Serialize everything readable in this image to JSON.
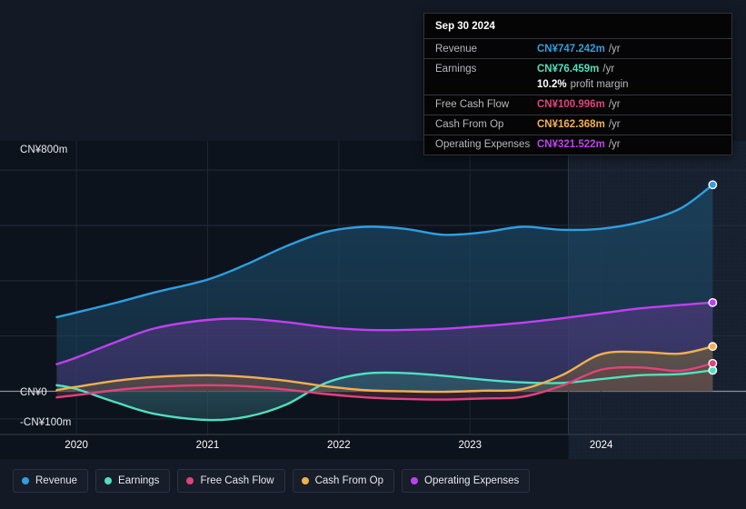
{
  "chart_data": {
    "type": "area",
    "title": "",
    "xlabel": "",
    "ylabel": "",
    "currency": "CN¥",
    "xlim": [
      2019.75,
      2025.0
    ],
    "ylim": [
      -130,
      840
    ],
    "grid": true,
    "x_ticks": [
      "2020",
      "2021",
      "2022",
      "2023",
      "2024"
    ],
    "x_tick_values": [
      2020,
      2021,
      2022,
      2023,
      2024
    ],
    "y_ticks": [
      "CN¥800m",
      "CN¥0",
      "-CN¥100m"
    ],
    "y_tick_values": [
      800,
      0,
      -100
    ],
    "gridline_values": [
      800,
      600,
      400,
      200,
      0,
      -100
    ],
    "forecast_divider_x": 2023.75,
    "legend_position": "bottom-left",
    "series": [
      {
        "name": "Revenue",
        "color": "#2f9fe0",
        "fill": "#1b4764",
        "end_value": 747.242,
        "x": [
          2019.85,
          2020.0,
          2020.3,
          2020.6,
          2021.0,
          2021.3,
          2021.6,
          2021.9,
          2022.2,
          2022.5,
          2022.8,
          2023.1,
          2023.4,
          2023.7,
          2024.0,
          2024.3,
          2024.6,
          2024.85
        ],
        "values": [
          268,
          285,
          320,
          358,
          404,
          460,
          525,
          576,
          595,
          588,
          566,
          575,
          595,
          584,
          588,
          612,
          660,
          747
        ]
      },
      {
        "name": "Earnings",
        "color": "#4fe0c0",
        "fill": "#2f5f6b",
        "end_value": 76.459,
        "x": [
          2019.85,
          2020.0,
          2020.3,
          2020.6,
          2021.0,
          2021.3,
          2021.6,
          2021.9,
          2022.2,
          2022.5,
          2022.8,
          2023.1,
          2023.4,
          2023.7,
          2024.0,
          2024.3,
          2024.6,
          2024.85
        ],
        "values": [
          22,
          8,
          -40,
          -82,
          -104,
          -92,
          -48,
          30,
          64,
          66,
          56,
          42,
          32,
          30,
          44,
          58,
          62,
          76
        ]
      },
      {
        "name": "Free Cash Flow",
        "color": "#e0437e",
        "fill": "#5e2a43",
        "end_value": 100.996,
        "x": [
          2019.85,
          2020.0,
          2020.3,
          2020.6,
          2021.0,
          2021.3,
          2021.6,
          2021.9,
          2022.2,
          2022.5,
          2022.8,
          2023.1,
          2023.4,
          2023.7,
          2024.0,
          2024.3,
          2024.6,
          2024.85
        ],
        "values": [
          -22,
          -14,
          4,
          16,
          22,
          18,
          6,
          -10,
          -22,
          -28,
          -30,
          -26,
          -20,
          20,
          78,
          86,
          74,
          101
        ]
      },
      {
        "name": "Cash From Op",
        "color": "#f0b050",
        "fill": "#6b5a3f",
        "end_value": 162.368,
        "x": [
          2019.85,
          2020.0,
          2020.3,
          2020.6,
          2021.0,
          2021.3,
          2021.6,
          2021.9,
          2022.2,
          2022.5,
          2022.8,
          2023.1,
          2023.4,
          2023.7,
          2024.0,
          2024.3,
          2024.6,
          2024.85
        ],
        "values": [
          4,
          16,
          38,
          52,
          58,
          52,
          38,
          18,
          4,
          0,
          -2,
          2,
          8,
          58,
          134,
          142,
          136,
          162
        ]
      },
      {
        "name": "Operating Expenses",
        "color": "#c040f0",
        "fill": "#4a3878",
        "end_value": 321.522,
        "x": [
          2019.85,
          2020.0,
          2020.3,
          2020.6,
          2021.0,
          2021.3,
          2021.6,
          2021.9,
          2022.2,
          2022.5,
          2022.8,
          2023.1,
          2023.4,
          2023.7,
          2024.0,
          2024.3,
          2024.6,
          2024.85
        ],
        "values": [
          98,
          122,
          178,
          228,
          258,
          262,
          250,
          232,
          222,
          222,
          226,
          236,
          248,
          264,
          282,
          300,
          312,
          321
        ]
      }
    ]
  },
  "tooltip": {
    "date": "Sep 30 2024",
    "rows": [
      {
        "label": "Revenue",
        "value": "CN¥747.242m",
        "unit": "/yr",
        "color": "#2f9fe0"
      },
      {
        "label": "Earnings",
        "value": "CN¥76.459m",
        "unit": "/yr",
        "color": "#4fe0c0"
      },
      {
        "label": "",
        "value": "10.2%",
        "unit": "profit margin",
        "color": "#ffffff",
        "sub": true
      },
      {
        "label": "Free Cash Flow",
        "value": "CN¥100.996m",
        "unit": "/yr",
        "color": "#e0437e"
      },
      {
        "label": "Cash From Op",
        "value": "CN¥162.368m",
        "unit": "/yr",
        "color": "#f0b050"
      },
      {
        "label": "Operating Expenses",
        "value": "CN¥321.522m",
        "unit": "/yr",
        "color": "#c040f0"
      }
    ]
  },
  "legend": {
    "items": [
      {
        "label": "Revenue",
        "color": "#2f9fe0"
      },
      {
        "label": "Earnings",
        "color": "#4fe0c0"
      },
      {
        "label": "Free Cash Flow",
        "color": "#e0437e"
      },
      {
        "label": "Cash From Op",
        "color": "#f0b050"
      },
      {
        "label": "Operating Expenses",
        "color": "#c040f0"
      }
    ]
  },
  "axis": {
    "y_top_label": "CN¥800m",
    "y_zero_label": "CN¥0",
    "y_neg_label": "-CN¥100m"
  }
}
